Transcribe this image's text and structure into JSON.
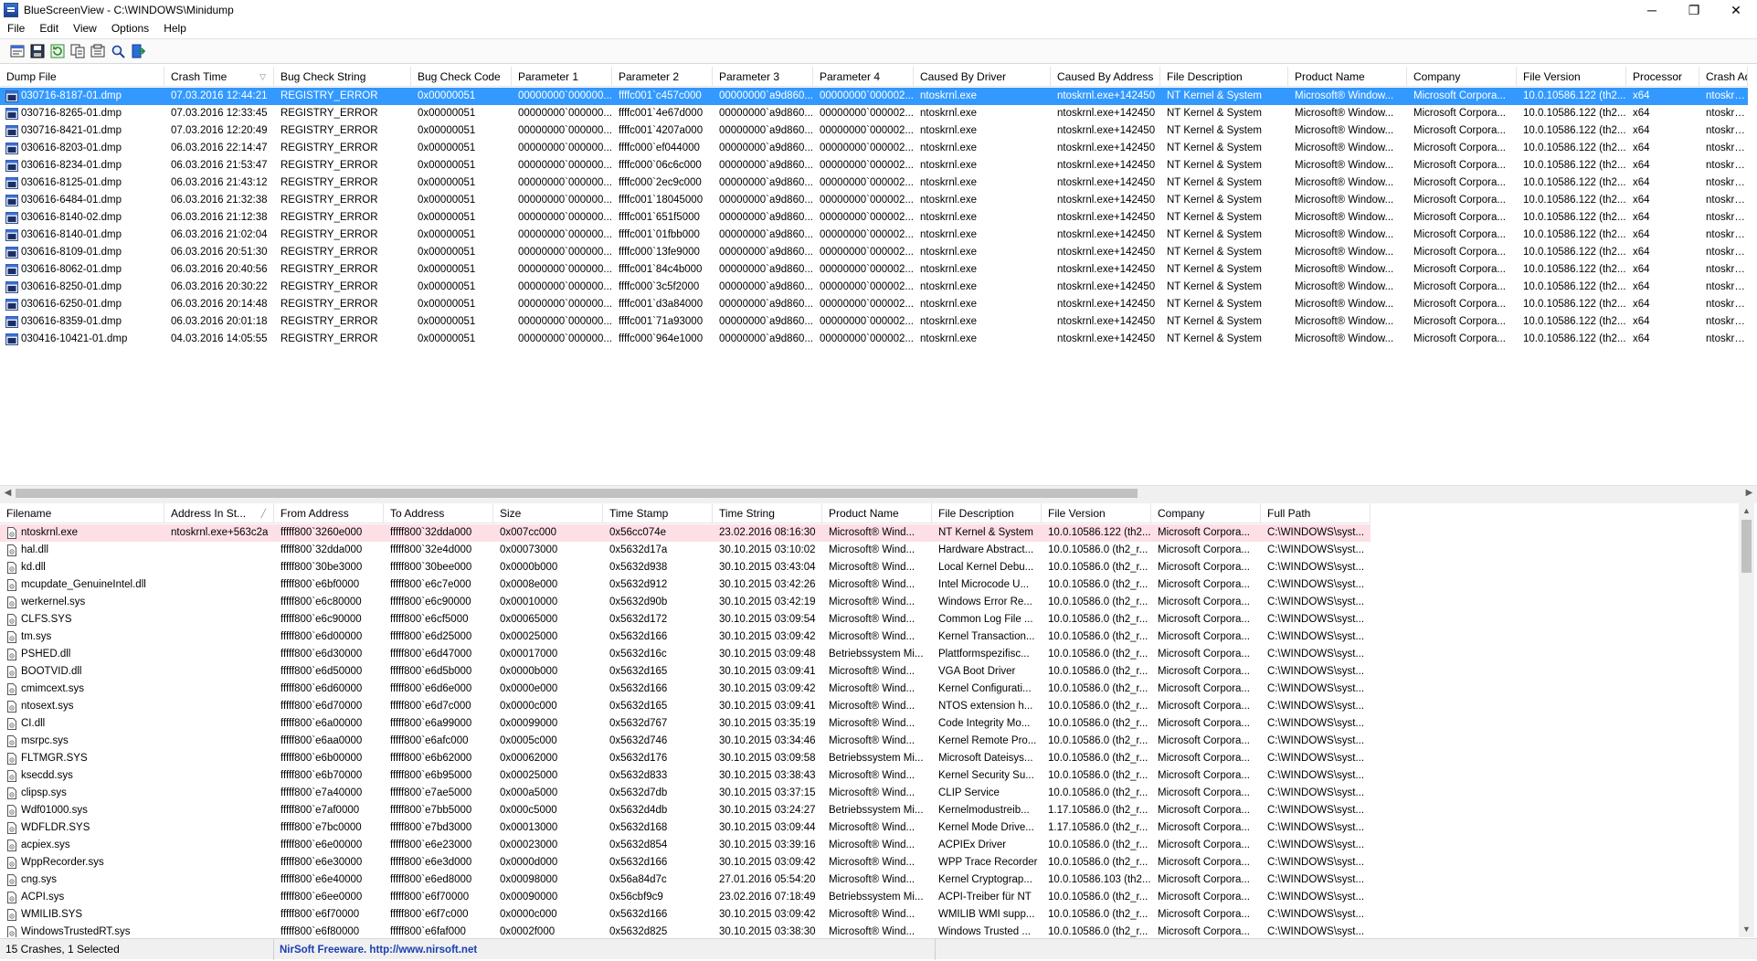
{
  "window": {
    "title": "BlueScreenView  -  C:\\WINDOWS\\Minidump",
    "minimize": "─",
    "maximize": "❐",
    "close": "✕"
  },
  "menu": [
    "File",
    "Edit",
    "View",
    "Options",
    "Help"
  ],
  "toolbar": [
    "properties-icon",
    "save-icon",
    "refresh-icon",
    "copy-icon",
    "options-icon",
    "find-icon",
    "exit-icon"
  ],
  "crashes": {
    "columns": [
      "Dump File",
      "Crash Time",
      "Bug Check String",
      "Bug Check Code",
      "Parameter 1",
      "Parameter 2",
      "Parameter 3",
      "Parameter 4",
      "Caused By Driver",
      "Caused By Address",
      "File Description",
      "Product Name",
      "Company",
      "File Version",
      "Processor",
      "Crash Addr"
    ],
    "rows": [
      [
        "030716-8187-01.dmp",
        "07.03.2016 12:44:21",
        "REGISTRY_ERROR",
        "0x00000051",
        "00000000`000000...",
        "ffffc001`c457c000",
        "00000000`a9d860...",
        "00000000`000002...",
        "ntoskrnl.exe",
        "ntoskrnl.exe+142450",
        "NT Kernel & System",
        "Microsoft® Window...",
        "Microsoft Corpora...",
        "10.0.10586.122 (th2...",
        "x64",
        "ntoskrnl.e"
      ],
      [
        "030716-8265-01.dmp",
        "07.03.2016 12:33:45",
        "REGISTRY_ERROR",
        "0x00000051",
        "00000000`000000...",
        "ffffc001`4e67d000",
        "00000000`a9d860...",
        "00000000`000002...",
        "ntoskrnl.exe",
        "ntoskrnl.exe+142450",
        "NT Kernel & System",
        "Microsoft® Window...",
        "Microsoft Corpora...",
        "10.0.10586.122 (th2...",
        "x64",
        "ntoskrnl.e"
      ],
      [
        "030716-8421-01.dmp",
        "07.03.2016 12:20:49",
        "REGISTRY_ERROR",
        "0x00000051",
        "00000000`000000...",
        "ffffc001`4207a000",
        "00000000`a9d860...",
        "00000000`000002...",
        "ntoskrnl.exe",
        "ntoskrnl.exe+142450",
        "NT Kernel & System",
        "Microsoft® Window...",
        "Microsoft Corpora...",
        "10.0.10586.122 (th2...",
        "x64",
        "ntoskrnl.e"
      ],
      [
        "030616-8203-01.dmp",
        "06.03.2016 22:14:47",
        "REGISTRY_ERROR",
        "0x00000051",
        "00000000`000000...",
        "ffffc000`ef044000",
        "00000000`a9d860...",
        "00000000`000002...",
        "ntoskrnl.exe",
        "ntoskrnl.exe+142450",
        "NT Kernel & System",
        "Microsoft® Window...",
        "Microsoft Corpora...",
        "10.0.10586.122 (th2...",
        "x64",
        "ntoskrnl.e"
      ],
      [
        "030616-8234-01.dmp",
        "06.03.2016 21:53:47",
        "REGISTRY_ERROR",
        "0x00000051",
        "00000000`000000...",
        "ffffc000`06c6c000",
        "00000000`a9d860...",
        "00000000`000002...",
        "ntoskrnl.exe",
        "ntoskrnl.exe+142450",
        "NT Kernel & System",
        "Microsoft® Window...",
        "Microsoft Corpora...",
        "10.0.10586.122 (th2...",
        "x64",
        "ntoskrnl.e"
      ],
      [
        "030616-8125-01.dmp",
        "06.03.2016 21:43:12",
        "REGISTRY_ERROR",
        "0x00000051",
        "00000000`000000...",
        "ffffc000`2ec9c000",
        "00000000`a9d860...",
        "00000000`000002...",
        "ntoskrnl.exe",
        "ntoskrnl.exe+142450",
        "NT Kernel & System",
        "Microsoft® Window...",
        "Microsoft Corpora...",
        "10.0.10586.122 (th2...",
        "x64",
        "ntoskrnl.e"
      ],
      [
        "030616-6484-01.dmp",
        "06.03.2016 21:32:38",
        "REGISTRY_ERROR",
        "0x00000051",
        "00000000`000000...",
        "ffffc001`18045000",
        "00000000`a9d860...",
        "00000000`000002...",
        "ntoskrnl.exe",
        "ntoskrnl.exe+142450",
        "NT Kernel & System",
        "Microsoft® Window...",
        "Microsoft Corpora...",
        "10.0.10586.122 (th2...",
        "x64",
        "ntoskrnl.e"
      ],
      [
        "030616-8140-02.dmp",
        "06.03.2016 21:12:38",
        "REGISTRY_ERROR",
        "0x00000051",
        "00000000`000000...",
        "ffffc001`651f5000",
        "00000000`a9d860...",
        "00000000`000002...",
        "ntoskrnl.exe",
        "ntoskrnl.exe+142450",
        "NT Kernel & System",
        "Microsoft® Window...",
        "Microsoft Corpora...",
        "10.0.10586.122 (th2...",
        "x64",
        "ntoskrnl.e"
      ],
      [
        "030616-8140-01.dmp",
        "06.03.2016 21:02:04",
        "REGISTRY_ERROR",
        "0x00000051",
        "00000000`000000...",
        "ffffc001`01fbb000",
        "00000000`a9d860...",
        "00000000`000002...",
        "ntoskrnl.exe",
        "ntoskrnl.exe+142450",
        "NT Kernel & System",
        "Microsoft® Window...",
        "Microsoft Corpora...",
        "10.0.10586.122 (th2...",
        "x64",
        "ntoskrnl.e"
      ],
      [
        "030616-8109-01.dmp",
        "06.03.2016 20:51:30",
        "REGISTRY_ERROR",
        "0x00000051",
        "00000000`000000...",
        "ffffc000`13fe9000",
        "00000000`a9d860...",
        "00000000`000002...",
        "ntoskrnl.exe",
        "ntoskrnl.exe+142450",
        "NT Kernel & System",
        "Microsoft® Window...",
        "Microsoft Corpora...",
        "10.0.10586.122 (th2...",
        "x64",
        "ntoskrnl.e"
      ],
      [
        "030616-8062-01.dmp",
        "06.03.2016 20:40:56",
        "REGISTRY_ERROR",
        "0x00000051",
        "00000000`000000...",
        "ffffc001`84c4b000",
        "00000000`a9d860...",
        "00000000`000002...",
        "ntoskrnl.exe",
        "ntoskrnl.exe+142450",
        "NT Kernel & System",
        "Microsoft® Window...",
        "Microsoft Corpora...",
        "10.0.10586.122 (th2...",
        "x64",
        "ntoskrnl.e"
      ],
      [
        "030616-8250-01.dmp",
        "06.03.2016 20:30:22",
        "REGISTRY_ERROR",
        "0x00000051",
        "00000000`000000...",
        "ffffc000`3c5f2000",
        "00000000`a9d860...",
        "00000000`000002...",
        "ntoskrnl.exe",
        "ntoskrnl.exe+142450",
        "NT Kernel & System",
        "Microsoft® Window...",
        "Microsoft Corpora...",
        "10.0.10586.122 (th2...",
        "x64",
        "ntoskrnl.e"
      ],
      [
        "030616-6250-01.dmp",
        "06.03.2016 20:14:48",
        "REGISTRY_ERROR",
        "0x00000051",
        "00000000`000000...",
        "ffffc001`d3a84000",
        "00000000`a9d860...",
        "00000000`000002...",
        "ntoskrnl.exe",
        "ntoskrnl.exe+142450",
        "NT Kernel & System",
        "Microsoft® Window...",
        "Microsoft Corpora...",
        "10.0.10586.122 (th2...",
        "x64",
        "ntoskrnl.e"
      ],
      [
        "030616-8359-01.dmp",
        "06.03.2016 20:01:18",
        "REGISTRY_ERROR",
        "0x00000051",
        "00000000`000000...",
        "ffffc001`71a93000",
        "00000000`a9d860...",
        "00000000`000002...",
        "ntoskrnl.exe",
        "ntoskrnl.exe+142450",
        "NT Kernel & System",
        "Microsoft® Window...",
        "Microsoft Corpora...",
        "10.0.10586.122 (th2...",
        "x64",
        "ntoskrnl.e"
      ],
      [
        "030416-10421-01.dmp",
        "04.03.2016 14:05:55",
        "REGISTRY_ERROR",
        "0x00000051",
        "00000000`000000...",
        "ffffc000`964e1000",
        "00000000`a9d860...",
        "00000000`000002...",
        "ntoskrnl.exe",
        "ntoskrnl.exe+142450",
        "NT Kernel & System",
        "Microsoft® Window...",
        "Microsoft Corpora...",
        "10.0.10586.122 (th2...",
        "x64",
        "ntoskrnl.e"
      ]
    ]
  },
  "drivers": {
    "columns": [
      "Filename",
      "Address In St...",
      "From Address",
      "To Address",
      "Size",
      "Time Stamp",
      "Time String",
      "Product Name",
      "File Description",
      "File Version",
      "Company",
      "Full Path"
    ],
    "rows": [
      [
        "ntoskrnl.exe",
        "ntoskrnl.exe+563c2a",
        "fffff800`3260e000",
        "fffff800`32dda000",
        "0x007cc000",
        "0x56cc074e",
        "23.02.2016 08:16:30",
        "Microsoft® Wind...",
        "NT Kernel & System",
        "10.0.10586.122 (th2...",
        "Microsoft Corpora...",
        "C:\\WINDOWS\\syst..."
      ],
      [
        "hal.dll",
        "",
        "fffff800`32dda000",
        "fffff800`32e4d000",
        "0x00073000",
        "0x5632d17a",
        "30.10.2015 03:10:02",
        "Microsoft® Wind...",
        "Hardware Abstract...",
        "10.0.10586.0 (th2_r...",
        "Microsoft Corpora...",
        "C:\\WINDOWS\\syst..."
      ],
      [
        "kd.dll",
        "",
        "fffff800`30be3000",
        "fffff800`30bee000",
        "0x0000b000",
        "0x5632d938",
        "30.10.2015 03:43:04",
        "Microsoft® Wind...",
        "Local Kernel Debu...",
        "10.0.10586.0 (th2_r...",
        "Microsoft Corpora...",
        "C:\\WINDOWS\\syst..."
      ],
      [
        "mcupdate_GenuineIntel.dll",
        "",
        "fffff800`e6bf0000",
        "fffff800`e6c7e000",
        "0x0008e000",
        "0x5632d912",
        "30.10.2015 03:42:26",
        "Microsoft® Wind...",
        "Intel Microcode U...",
        "10.0.10586.0 (th2_r...",
        "Microsoft Corpora...",
        "C:\\WINDOWS\\syst..."
      ],
      [
        "werkernel.sys",
        "",
        "fffff800`e6c80000",
        "fffff800`e6c90000",
        "0x00010000",
        "0x5632d90b",
        "30.10.2015 03:42:19",
        "Microsoft® Wind...",
        "Windows Error Re...",
        "10.0.10586.0 (th2_r...",
        "Microsoft Corpora...",
        "C:\\WINDOWS\\syst..."
      ],
      [
        "CLFS.SYS",
        "",
        "fffff800`e6c90000",
        "fffff800`e6cf5000",
        "0x00065000",
        "0x5632d172",
        "30.10.2015 03:09:54",
        "Microsoft® Wind...",
        "Common Log File ...",
        "10.0.10586.0 (th2_r...",
        "Microsoft Corpora...",
        "C:\\WINDOWS\\syst..."
      ],
      [
        "tm.sys",
        "",
        "fffff800`e6d00000",
        "fffff800`e6d25000",
        "0x00025000",
        "0x5632d166",
        "30.10.2015 03:09:42",
        "Microsoft® Wind...",
        "Kernel Transaction...",
        "10.0.10586.0 (th2_r...",
        "Microsoft Corpora...",
        "C:\\WINDOWS\\syst..."
      ],
      [
        "PSHED.dll",
        "",
        "fffff800`e6d30000",
        "fffff800`e6d47000",
        "0x00017000",
        "0x5632d16c",
        "30.10.2015 03:09:48",
        "Betriebssystem Mi...",
        "Plattformspezifisc...",
        "10.0.10586.0 (th2_r...",
        "Microsoft Corpora...",
        "C:\\WINDOWS\\syst..."
      ],
      [
        "BOOTVID.dll",
        "",
        "fffff800`e6d50000",
        "fffff800`e6d5b000",
        "0x0000b000",
        "0x5632d165",
        "30.10.2015 03:09:41",
        "Microsoft® Wind...",
        "VGA Boot Driver",
        "10.0.10586.0 (th2_r...",
        "Microsoft Corpora...",
        "C:\\WINDOWS\\syst..."
      ],
      [
        "cmimcext.sys",
        "",
        "fffff800`e6d60000",
        "fffff800`e6d6e000",
        "0x0000e000",
        "0x5632d166",
        "30.10.2015 03:09:42",
        "Microsoft® Wind...",
        "Kernel Configurati...",
        "10.0.10586.0 (th2_r...",
        "Microsoft Corpora...",
        "C:\\WINDOWS\\syst..."
      ],
      [
        "ntosext.sys",
        "",
        "fffff800`e6d70000",
        "fffff800`e6d7c000",
        "0x0000c000",
        "0x5632d165",
        "30.10.2015 03:09:41",
        "Microsoft® Wind...",
        "NTOS extension h...",
        "10.0.10586.0 (th2_r...",
        "Microsoft Corpora...",
        "C:\\WINDOWS\\syst..."
      ],
      [
        "CI.dll",
        "",
        "fffff800`e6a00000",
        "fffff800`e6a99000",
        "0x00099000",
        "0x5632d767",
        "30.10.2015 03:35:19",
        "Microsoft® Wind...",
        "Code Integrity Mo...",
        "10.0.10586.0 (th2_r...",
        "Microsoft Corpora...",
        "C:\\WINDOWS\\syst..."
      ],
      [
        "msrpc.sys",
        "",
        "fffff800`e6aa0000",
        "fffff800`e6afc000",
        "0x0005c000",
        "0x5632d746",
        "30.10.2015 03:34:46",
        "Microsoft® Wind...",
        "Kernel Remote Pro...",
        "10.0.10586.0 (th2_r...",
        "Microsoft Corpora...",
        "C:\\WINDOWS\\syst..."
      ],
      [
        "FLTMGR.SYS",
        "",
        "fffff800`e6b00000",
        "fffff800`e6b62000",
        "0x00062000",
        "0x5632d176",
        "30.10.2015 03:09:58",
        "Betriebssystem Mi...",
        "Microsoft Dateisys...",
        "10.0.10586.0 (th2_r...",
        "Microsoft Corpora...",
        "C:\\WINDOWS\\syst..."
      ],
      [
        "ksecdd.sys",
        "",
        "fffff800`e6b70000",
        "fffff800`e6b95000",
        "0x00025000",
        "0x5632d833",
        "30.10.2015 03:38:43",
        "Microsoft® Wind...",
        "Kernel Security Su...",
        "10.0.10586.0 (th2_r...",
        "Microsoft Corpora...",
        "C:\\WINDOWS\\syst..."
      ],
      [
        "clipsp.sys",
        "",
        "fffff800`e7a40000",
        "fffff800`e7ae5000",
        "0x000a5000",
        "0x5632d7db",
        "30.10.2015 03:37:15",
        "Microsoft® Wind...",
        "CLIP Service",
        "10.0.10586.0 (th2_r...",
        "Microsoft Corpora...",
        "C:\\WINDOWS\\syst..."
      ],
      [
        "Wdf01000.sys",
        "",
        "fffff800`e7af0000",
        "fffff800`e7bb5000",
        "0x000c5000",
        "0x5632d4db",
        "30.10.2015 03:24:27",
        "Betriebssystem Mi...",
        "Kernelmodustreib...",
        "1.17.10586.0 (th2_r...",
        "Microsoft Corpora...",
        "C:\\WINDOWS\\syst..."
      ],
      [
        "WDFLDR.SYS",
        "",
        "fffff800`e7bc0000",
        "fffff800`e7bd3000",
        "0x00013000",
        "0x5632d168",
        "30.10.2015 03:09:44",
        "Microsoft® Wind...",
        "Kernel Mode Drive...",
        "1.17.10586.0 (th2_r...",
        "Microsoft Corpora...",
        "C:\\WINDOWS\\syst..."
      ],
      [
        "acpiex.sys",
        "",
        "fffff800`e6e00000",
        "fffff800`e6e23000",
        "0x00023000",
        "0x5632d854",
        "30.10.2015 03:39:16",
        "Microsoft® Wind...",
        "ACPIEx Driver",
        "10.0.10586.0 (th2_r...",
        "Microsoft Corpora...",
        "C:\\WINDOWS\\syst..."
      ],
      [
        "WppRecorder.sys",
        "",
        "fffff800`e6e30000",
        "fffff800`e6e3d000",
        "0x0000d000",
        "0x5632d166",
        "30.10.2015 03:09:42",
        "Microsoft® Wind...",
        "WPP Trace Recorder",
        "10.0.10586.0 (th2_r...",
        "Microsoft Corpora...",
        "C:\\WINDOWS\\syst..."
      ],
      [
        "cng.sys",
        "",
        "fffff800`e6e40000",
        "fffff800`e6ed8000",
        "0x00098000",
        "0x56a84d7c",
        "27.01.2016 05:54:20",
        "Microsoft® Wind...",
        "Kernel Cryptograp...",
        "10.0.10586.103 (th2...",
        "Microsoft Corpora...",
        "C:\\WINDOWS\\syst..."
      ],
      [
        "ACPI.sys",
        "",
        "fffff800`e6ee0000",
        "fffff800`e6f70000",
        "0x00090000",
        "0x56cbf9c9",
        "23.02.2016 07:18:49",
        "Betriebssystem Mi...",
        "ACPI-Treiber für NT",
        "10.0.10586.0 (th2_r...",
        "Microsoft Corpora...",
        "C:\\WINDOWS\\syst..."
      ],
      [
        "WMILIB.SYS",
        "",
        "fffff800`e6f70000",
        "fffff800`e6f7c000",
        "0x0000c000",
        "0x5632d166",
        "30.10.2015 03:09:42",
        "Microsoft® Wind...",
        "WMILIB WMI supp...",
        "10.0.10586.0 (th2_r...",
        "Microsoft Corpora...",
        "C:\\WINDOWS\\syst..."
      ],
      [
        "WindowsTrustedRT.sys",
        "",
        "fffff800`e6f80000",
        "fffff800`e6faf000",
        "0x0002f000",
        "0x5632d825",
        "30.10.2015 03:38:30",
        "Microsoft® Wind...",
        "Windows Trusted ...",
        "10.0.10586.0 (th2_r...",
        "Microsoft Corpora...",
        "C:\\WINDOWS\\syst..."
      ]
    ]
  },
  "status": {
    "summary": "15 Crashes, 1 Selected",
    "freeware": "NirSoft Freeware.  http://www.nirsoft.net"
  },
  "colors": {
    "selection": "#3399ff",
    "highlight_row": "#fde0e6",
    "link": "#1a3fb0"
  }
}
